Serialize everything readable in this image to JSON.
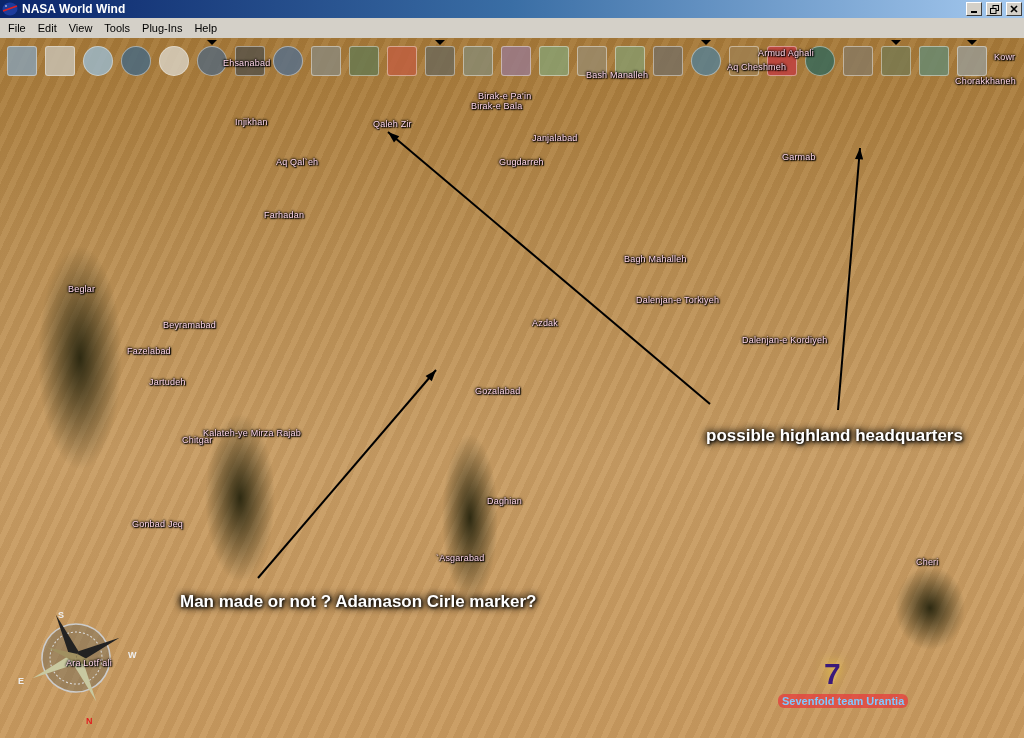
{
  "window": {
    "title": "NASA World Wind"
  },
  "menu": [
    "File",
    "Edit",
    "View",
    "Tools",
    "Plug-Ins",
    "Help"
  ],
  "toolbar": [
    {
      "active": false
    },
    {
      "active": false
    },
    {
      "active": false
    },
    {
      "active": false
    },
    {
      "active": false
    },
    {
      "active": true
    },
    {
      "active": false
    },
    {
      "active": false
    },
    {
      "active": false
    },
    {
      "active": false
    },
    {
      "active": false
    },
    {
      "active": true
    },
    {
      "active": false
    },
    {
      "active": false
    },
    {
      "active": false
    },
    {
      "active": false
    },
    {
      "active": false
    },
    {
      "active": false
    },
    {
      "active": true
    },
    {
      "active": false
    },
    {
      "active": false
    },
    {
      "active": false
    },
    {
      "active": false
    },
    {
      "active": true
    },
    {
      "active": false
    },
    {
      "active": true
    }
  ],
  "place_labels": [
    "Ehsanabad",
    "Armud Aghali",
    "Aq Cheshmeh",
    "Bash Manalleh",
    "Kowr",
    "Chorakkhaneh",
    "Birak-e Pa'in",
    "Birak-e Bala",
    "Injikhan",
    "Qaleh Zir",
    "Janjalabad",
    "Aq Qal`eh",
    "Gugdarreh",
    "Garmab",
    "Farhadan",
    "Bagh Mahalleh",
    "Beglar",
    "Dalenjan-e Torkiyeh",
    "Azdak",
    "Beyramabad",
    "Dalenjan-e Kordiyeh",
    "Fazelabad",
    "Jartudeh",
    "Gozalabad",
    "Kalateh-ye Mirza Rajab",
    "Chitgar",
    "Daghian",
    "Gonbad Jeq",
    "`Asgarabad",
    "Cheri",
    "Ara Lotf`ali"
  ],
  "annotations": [
    "possible highland headquarters",
    "Man made or not ? Adamason Cirle marker?"
  ],
  "compass": [
    "S",
    "W",
    "E",
    "N"
  ],
  "logo": {
    "numeral": "7",
    "text": "Sevenfold team Urantia"
  }
}
